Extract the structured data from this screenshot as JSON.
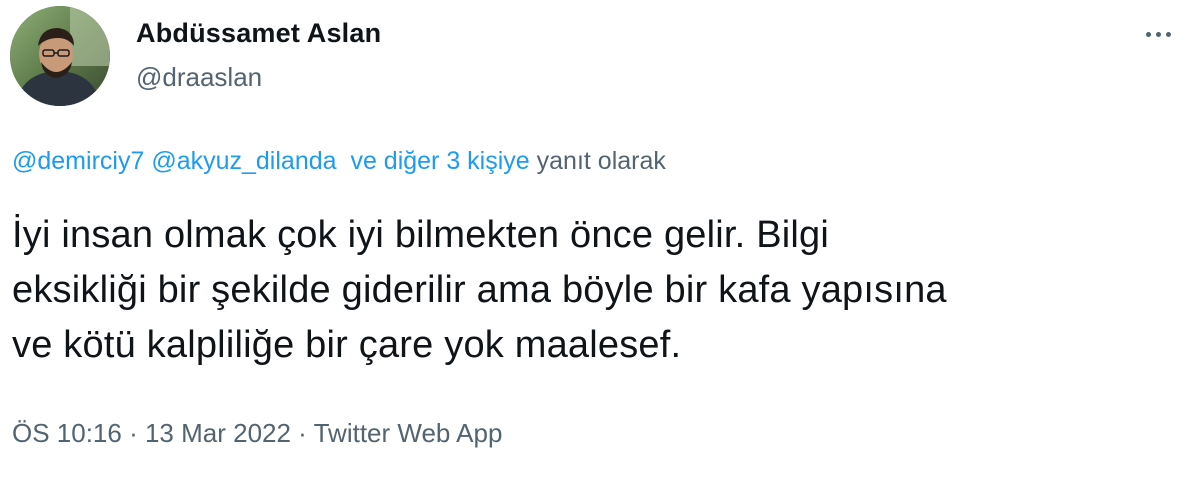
{
  "author": {
    "name": "Abdüssamet Aslan",
    "handle": "@draaslan"
  },
  "reply": {
    "mention_1": "@demirciy7",
    "mention_2": "@akyuz_dilanda",
    "others": "ve diğer 3 kişiye",
    "suffix": "yanıt olarak"
  },
  "tweet": {
    "lines": [
      "İyi insan olmak çok iyi bilmekten önce gelir. Bilgi",
      "eksikliği bir şekilde giderilir ama böyle bir kafa yapısına",
      "ve kötü kalpliliğe bir çare yok maalesef."
    ]
  },
  "meta": {
    "time": "ÖS 10:16",
    "sep1": " · ",
    "date": "13 Mar 2022",
    "sep2": " · ",
    "source": "Twitter Web App"
  },
  "icons": {
    "more": "more-horizontal-icon"
  },
  "colors": {
    "link": "#1d9bf0",
    "secondary": "#536471",
    "text": "#0f1419"
  }
}
